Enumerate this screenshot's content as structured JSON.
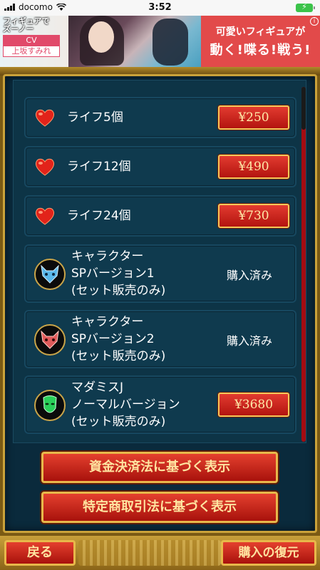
{
  "status_bar": {
    "carrier": "docomo",
    "time": "3:52",
    "battery_icon": "battery-charging-icon"
  },
  "ad": {
    "title_line1": "フィギュアで",
    "title_line2": "ズーノー",
    "cv_label": "CV",
    "voice_actor": "上坂すみれ",
    "headline": "可愛いフィギュアが",
    "tagline": "動く!喋る!戦う!",
    "info_glyph": "i"
  },
  "items": [
    {
      "label": "ライフ5個",
      "price": "¥250",
      "icon": "heart-icon"
    },
    {
      "label": "ライフ12個",
      "price": "¥490",
      "icon": "heart-icon"
    },
    {
      "label": "ライフ24個",
      "price": "¥730",
      "icon": "heart-icon"
    },
    {
      "label_lines": [
        "キャラクター",
        "SPバージョン1",
        "(セット販売のみ)"
      ],
      "status": "購入済み",
      "icon": "blue-wolf-mask-icon"
    },
    {
      "label_lines": [
        "キャラクター",
        "SPバージョン2",
        "(セット販売のみ)"
      ],
      "status": "購入済み",
      "icon": "red-wolf-mask-icon"
    },
    {
      "label_lines": [
        "マダミスJ",
        "ノーマルバージョン",
        "(セット販売のみ)"
      ],
      "price": "¥3680",
      "icon": "green-mask-icon"
    }
  ],
  "buttons": {
    "payment_law": "資金決済法に基づく表示",
    "commerce_law": "特定商取引法に基づく表示",
    "back": "戻る",
    "restore": "購入の復元"
  },
  "colors": {
    "button_red": "#c82018",
    "gold_border": "#e8b84a",
    "panel_bg": "#0d3446"
  }
}
